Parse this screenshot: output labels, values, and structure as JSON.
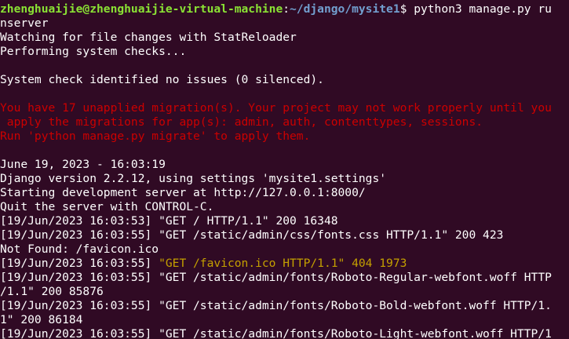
{
  "palette": {
    "background": "#300a24",
    "text": "#ffffff",
    "prompt_user": "#8ae234",
    "prompt_path": "#729fcf",
    "error": "#cc0000",
    "warning": "#c4a000"
  },
  "terminal": {
    "prompt": {
      "user_host": "zhenghuaijie@zhenghuaijie-virtual-machine",
      "separator": ":",
      "path": "~/django/mysite1",
      "dollar": "$ ",
      "command_part1": "python3 manage.py ru",
      "command_part2": "nserver"
    },
    "startup": {
      "watching": "Watching for file changes with StatReloader",
      "checks": "Performing system checks...",
      "check_result": "System check identified no issues (0 silenced)."
    },
    "migration_warning": {
      "line1": "You have 17 unapplied migration(s). Your project may not work properly until you",
      "line2": " apply the migrations for app(s): admin, auth, contenttypes, sessions.",
      "line3": "Run 'python manage.py migrate' to apply them."
    },
    "server_info": {
      "datetime": "June 19, 2023 - 16:03:19",
      "django_version": "Django version 2.2.12, using settings 'mysite1.settings'",
      "starting": "Starting development server at http://127.0.0.1:8000/",
      "quit": "Quit the server with CONTROL-C."
    },
    "log": {
      "l1": "[19/Jun/2023 16:03:53] \"GET / HTTP/1.1\" 200 16348",
      "l2": "[19/Jun/2023 16:03:55] \"GET /static/admin/css/fonts.css HTTP/1.1\" 200 423",
      "l3": "Not Found: /favicon.ico",
      "l4_prefix": "[19/Jun/2023 16:03:55] ",
      "l4_request": "\"GET /favicon.ico HTTP/1.1\" 404 1973",
      "l5a": "[19/Jun/2023 16:03:55] \"GET /static/admin/fonts/Roboto-Regular-webfont.woff HTTP",
      "l5b": "/1.1\" 200 85876",
      "l6a": "[19/Jun/2023 16:03:55] \"GET /static/admin/fonts/Roboto-Bold-webfont.woff HTTP/1.",
      "l6b": "1\" 200 86184",
      "l7a": "[19/Jun/2023 16:03:55] \"GET /static/admin/fonts/Roboto-Light-webfont.woff HTTP/1"
    }
  }
}
